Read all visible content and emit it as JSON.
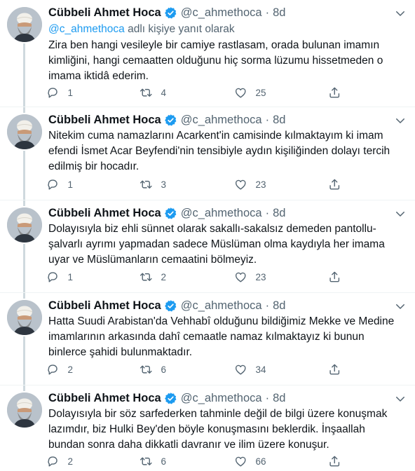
{
  "author": {
    "name": "Cübbeli Ahmet Hoca",
    "handle": "@c_ahmethoca",
    "separator": "·",
    "verified_icon": "verified-badge-icon",
    "avatar": "avatar-turban-portrait"
  },
  "reply_context": {
    "mention": "@c_ahmethoca",
    "suffix": " adlı kişiye yanıt olarak"
  },
  "colors": {
    "accent": "#1d9bf0",
    "secondary_text": "#536471",
    "primary_text": "#0f1419",
    "divider": "#eff3f4"
  },
  "tweets": [
    {
      "time": "8d",
      "text": "Zira ben hangi vesileyle bir camiye rastlasam, orada bulunan imamın kimliğini, hangi cemaatten olduğunu hiç sorma lüzumu hissetmeden o imama iktidâ ederim.",
      "replies": "1",
      "retweets": "4",
      "likes": "25"
    },
    {
      "time": "8d",
      "text": "Nitekim cuma namazlarını Acarkent'in camisinde kılmaktayım ki imam efendi İsmet Acar Beyfendi'nin tensibiyle aydın kişiliğinden dolayı tercih edilmiş bir hocadır.",
      "replies": "1",
      "retweets": "3",
      "likes": "23"
    },
    {
      "time": "8d",
      "text": "Dolayısıyla biz ehli sünnet olarak sakallı-sakalsız demeden pantollu-şalvarlı ayrımı yapmadan sadece Müslüman olma kaydıyla her imama uyar ve Müslümanların cemaatini bölmeyiz.",
      "replies": "1",
      "retweets": "2",
      "likes": "23"
    },
    {
      "time": "8d",
      "text": "Hatta Suudi Arabistan'da Vehhabî olduğunu bildiğimiz Mekke ve Medine imamlarının arkasında dahî cemaatle namaz kılmaktayız ki bunun binlerce şahidi bulunmaktadır.",
      "replies": "2",
      "retweets": "6",
      "likes": "34"
    },
    {
      "time": "8d",
      "text": "Dolayısıyla bir söz sarfederken tahminle değil de bilgi üzere konuşmak lazımdır, biz Hulki Bey'den böyle konuşmasını beklerdik. İnşaallah bundan sonra daha dikkatli davranır ve ilim üzere konuşur.",
      "replies": "2",
      "retweets": "6",
      "likes": "66"
    }
  ]
}
